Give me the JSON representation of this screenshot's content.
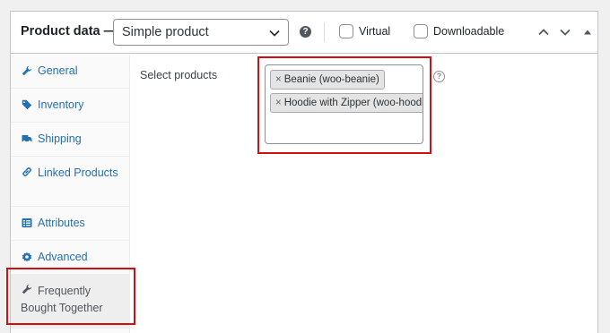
{
  "header": {
    "title": "Product data —",
    "product_type": "Simple product",
    "help_glyph": "?",
    "virtual_label": "Virtual",
    "downloadable_label": "Downloadable"
  },
  "sidebar": {
    "items": [
      {
        "label": "General",
        "icon": "wrench-icon"
      },
      {
        "label": "Inventory",
        "icon": "tag-icon"
      },
      {
        "label": "Shipping",
        "icon": "truck-icon"
      },
      {
        "label": "Linked Products",
        "icon": "link-icon"
      },
      {
        "label": "Attributes",
        "icon": "list-icon"
      },
      {
        "label": "Advanced",
        "icon": "gear-icon"
      },
      {
        "label": "Frequently Bought Together",
        "icon": "wrench-icon",
        "active": true
      }
    ]
  },
  "main": {
    "select_products_label": "Select products",
    "selected": [
      {
        "remove": "×",
        "label": "Beanie (woo-beanie)"
      },
      {
        "remove": "×",
        "label": "Hoodie with Zipper (woo-hoodie-with-zipper)"
      }
    ],
    "help_glyph": "?"
  },
  "colors": {
    "link": "#2271b1",
    "highlight": "#d10f12",
    "border": "#c3c4c7"
  }
}
